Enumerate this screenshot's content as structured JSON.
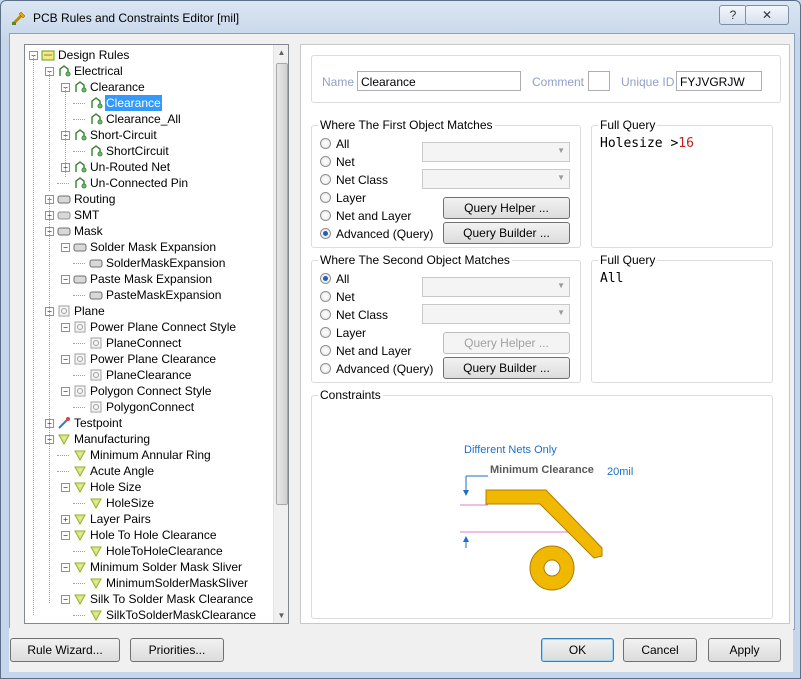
{
  "window": {
    "title": "PCB Rules and Constraints Editor [mil]",
    "help_label": "?",
    "close_label": "✕"
  },
  "tree": {
    "nodes": [
      {
        "label": "Design Rules",
        "level": 0,
        "exp": "−",
        "icon": "design-rules-icon"
      },
      {
        "label": "Electrical",
        "level": 1,
        "exp": "−",
        "icon": "electrical-icon"
      },
      {
        "label": "Clearance",
        "level": 2,
        "exp": "−",
        "icon": "clearance-icon"
      },
      {
        "label": "Clearance",
        "level": 3,
        "exp": "",
        "icon": "clearance-rule-icon",
        "selected": true
      },
      {
        "label": "Clearance_All",
        "level": 3,
        "exp": "",
        "icon": "clearance-rule-icon"
      },
      {
        "label": "Short-Circuit",
        "level": 2,
        "exp": "−",
        "icon": "short-circuit-icon"
      },
      {
        "label": "ShortCircuit",
        "level": 3,
        "exp": "",
        "icon": "short-circuit-rule-icon"
      },
      {
        "label": "Un-Routed Net",
        "level": 2,
        "exp": "+",
        "icon": "unrouted-net-icon"
      },
      {
        "label": "Un-Connected Pin",
        "level": 2,
        "exp": "",
        "icon": "unconnected-pin-icon"
      },
      {
        "label": "Routing",
        "level": 1,
        "exp": "+",
        "icon": "routing-icon"
      },
      {
        "label": "SMT",
        "level": 1,
        "exp": "+",
        "icon": "smt-icon"
      },
      {
        "label": "Mask",
        "level": 1,
        "exp": "−",
        "icon": "mask-icon"
      },
      {
        "label": "Solder Mask Expansion",
        "level": 2,
        "exp": "−",
        "icon": "mask-icon"
      },
      {
        "label": "SolderMaskExpansion",
        "level": 3,
        "exp": "",
        "icon": "mask-rule-icon"
      },
      {
        "label": "Paste Mask Expansion",
        "level": 2,
        "exp": "−",
        "icon": "mask-icon"
      },
      {
        "label": "PasteMaskExpansion",
        "level": 3,
        "exp": "",
        "icon": "mask-rule-icon"
      },
      {
        "label": "Plane",
        "level": 1,
        "exp": "−",
        "icon": "plane-icon"
      },
      {
        "label": "Power Plane Connect Style",
        "level": 2,
        "exp": "−",
        "icon": "plane-icon"
      },
      {
        "label": "PlaneConnect",
        "level": 3,
        "exp": "",
        "icon": "plane-rule-icon"
      },
      {
        "label": "Power Plane Clearance",
        "level": 2,
        "exp": "−",
        "icon": "plane-icon"
      },
      {
        "label": "PlaneClearance",
        "level": 3,
        "exp": "",
        "icon": "plane-rule-icon"
      },
      {
        "label": "Polygon Connect Style",
        "level": 2,
        "exp": "−",
        "icon": "plane-icon"
      },
      {
        "label": "PolygonConnect",
        "level": 3,
        "exp": "",
        "icon": "plane-rule-icon"
      },
      {
        "label": "Testpoint",
        "level": 1,
        "exp": "+",
        "icon": "testpoint-icon"
      },
      {
        "label": "Manufacturing",
        "level": 1,
        "exp": "−",
        "icon": "manufacturing-icon"
      },
      {
        "label": "Minimum Annular Ring",
        "level": 2,
        "exp": "",
        "icon": "manufacturing-icon"
      },
      {
        "label": "Acute Angle",
        "level": 2,
        "exp": "",
        "icon": "manufacturing-icon"
      },
      {
        "label": "Hole Size",
        "level": 2,
        "exp": "−",
        "icon": "manufacturing-icon"
      },
      {
        "label": "HoleSize",
        "level": 3,
        "exp": "",
        "icon": "manufacturing-rule-icon"
      },
      {
        "label": "Layer Pairs",
        "level": 2,
        "exp": "+",
        "icon": "manufacturing-icon"
      },
      {
        "label": "Hole To Hole Clearance",
        "level": 2,
        "exp": "−",
        "icon": "manufacturing-icon"
      },
      {
        "label": "HoleToHoleClearance",
        "level": 3,
        "exp": "",
        "icon": "manufacturing-rule-icon"
      },
      {
        "label": "Minimum Solder Mask Sliver",
        "level": 2,
        "exp": "−",
        "icon": "manufacturing-icon"
      },
      {
        "label": "MinimumSolderMaskSliver",
        "level": 3,
        "exp": "",
        "icon": "manufacturing-rule-icon"
      },
      {
        "label": "Silk To Solder Mask Clearance",
        "level": 2,
        "exp": "−",
        "icon": "manufacturing-icon"
      },
      {
        "label": "SilkToSolderMaskClearance",
        "level": 3,
        "exp": "",
        "icon": "manufacturing-rule-icon"
      }
    ]
  },
  "rule": {
    "name_label": "Name",
    "name_value": "Clearance",
    "comment_label": "Comment",
    "comment_value": "",
    "uid_label": "Unique ID",
    "uid_value": "FYJVGRJW"
  },
  "first": {
    "title": "Where The First Object Matches",
    "options": [
      "All",
      "Net",
      "Net Class",
      "Layer",
      "Net and Layer",
      "Advanced (Query)"
    ],
    "selected": 5,
    "query_helper": "Query Helper ...",
    "query_builder": "Query Builder ...",
    "full_query_title": "Full Query",
    "query_prefix": "Holesize >",
    "query_number": "16"
  },
  "second": {
    "title": "Where The Second Object Matches",
    "options": [
      "All",
      "Net",
      "Net Class",
      "Layer",
      "Net and Layer",
      "Advanced (Query)"
    ],
    "selected": 0,
    "query_helper": "Query Helper ...",
    "query_builder": "Query Builder ...",
    "full_query_title": "Full Query",
    "query_text": "All"
  },
  "constraints": {
    "title": "Constraints",
    "diff_nets": "Different Nets Only",
    "min_clearance": "Minimum Clearance",
    "value": "20mil",
    "track_color": "#f0b800",
    "track_edge": "#b07e00",
    "accent": "#1e6ec8"
  },
  "footer": {
    "rule_wizard": "Rule Wizard...",
    "priorities": "Priorities...",
    "ok": "OK",
    "cancel": "Cancel",
    "apply": "Apply"
  }
}
